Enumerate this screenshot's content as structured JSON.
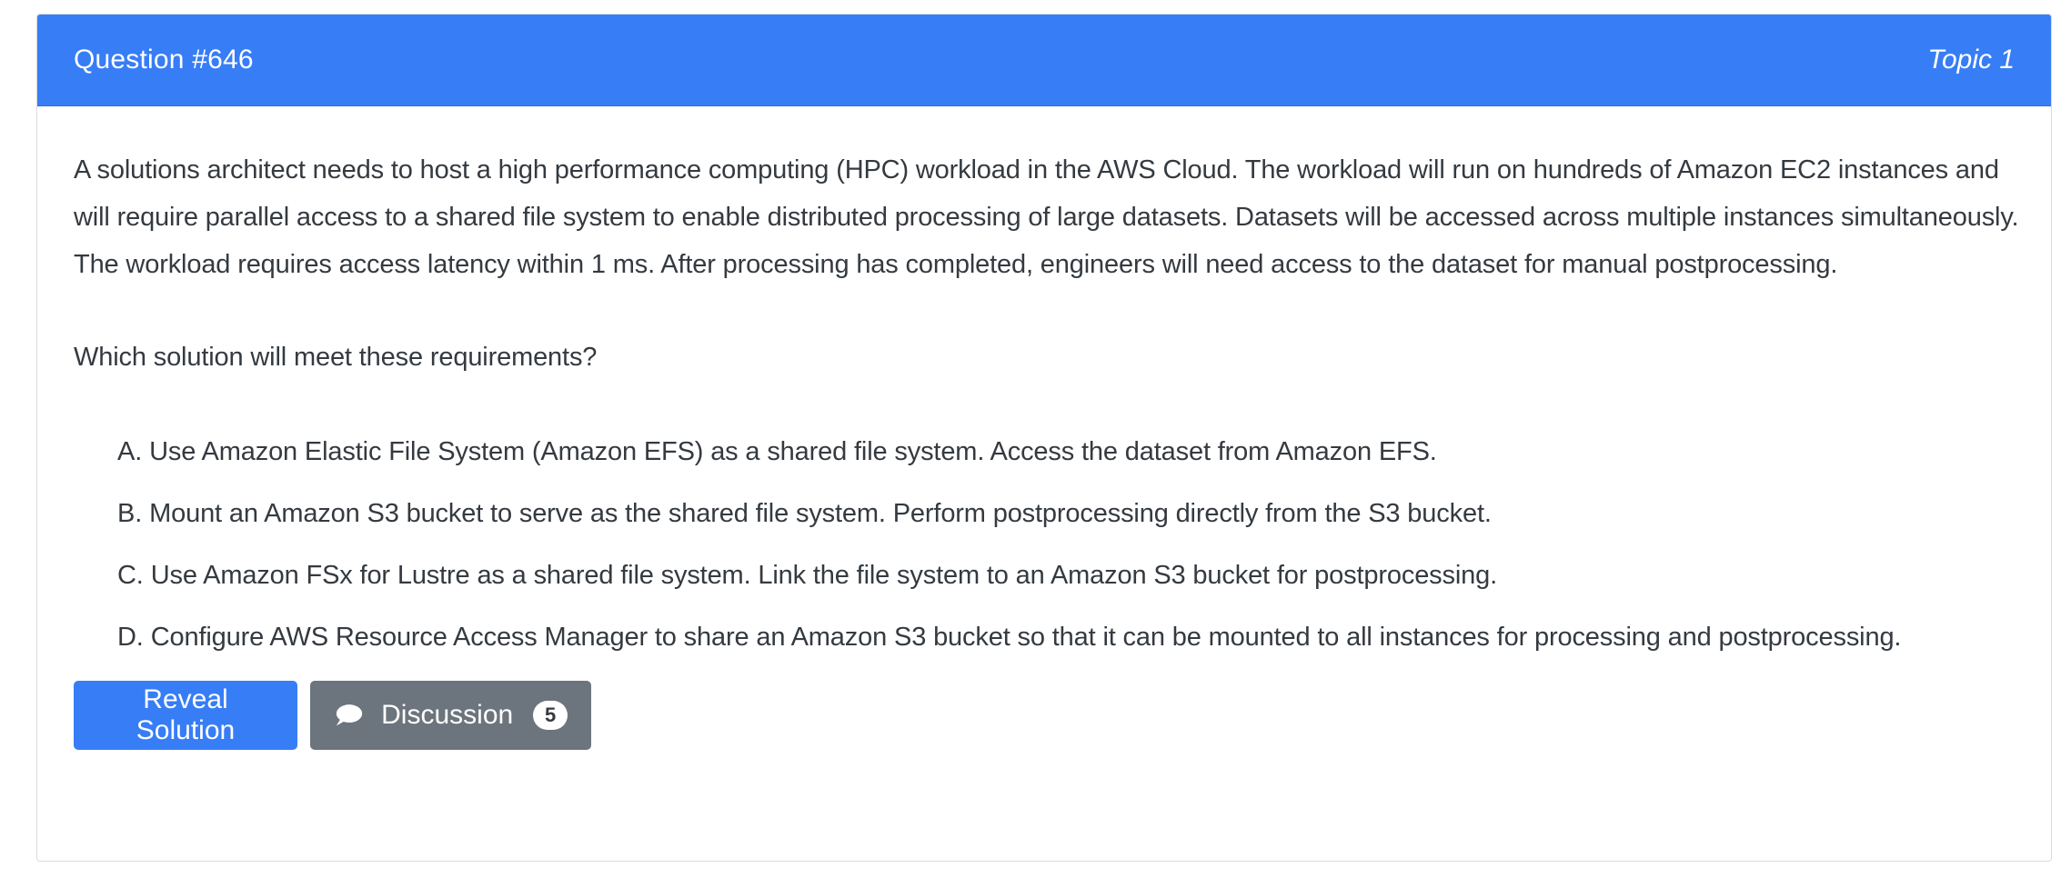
{
  "header": {
    "question_number": "Question #646",
    "topic": "Topic 1"
  },
  "question": {
    "text": "A solutions architect needs to host a high performance computing (HPC) workload in the AWS Cloud. The workload will run on hundreds of Amazon EC2 instances and will require parallel access to a shared file system to enable distributed processing of large datasets. Datasets will be accessed across multiple instances simultaneously. The workload requires access latency within 1 ms. After processing has completed, engineers will need access to the dataset for manual postprocessing.",
    "prompt": "Which solution will meet these requirements?"
  },
  "choices": [
    {
      "letter": "A.",
      "text": "Use Amazon Elastic File System (Amazon EFS) as a shared file system. Access the dataset from Amazon EFS."
    },
    {
      "letter": "B.",
      "text": "Mount an Amazon S3 bucket to serve as the shared file system. Perform postprocessing directly from the S3 bucket."
    },
    {
      "letter": "C.",
      "text": "Use Amazon FSx for Lustre as a shared file system. Link the file system to an Amazon S3 bucket for postprocessing."
    },
    {
      "letter": "D.",
      "text": "Configure AWS Resource Access Manager to share an Amazon S3 bucket so that it can be mounted to all instances for processing and postprocessing."
    }
  ],
  "actions": {
    "reveal_label": "Reveal Solution",
    "discussion_label": "Discussion",
    "discussion_count": "5",
    "discussion_icon": "chat-bubble-icon"
  },
  "colors": {
    "header_bg": "#377df6",
    "primary_button": "#377df6",
    "secondary_button": "#6c757d"
  }
}
